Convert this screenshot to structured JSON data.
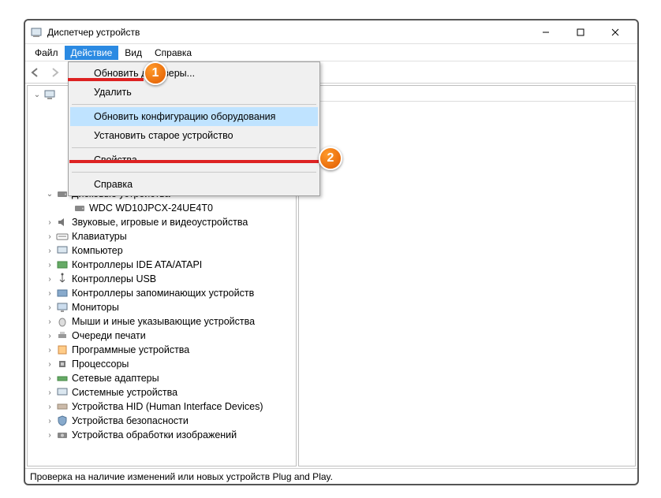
{
  "window": {
    "title": "Диспетчер устройств"
  },
  "menubar": {
    "file": "Файл",
    "action": "Действие",
    "view": "Вид",
    "help": "Справка"
  },
  "dropdown": {
    "update_drivers": "Обновить драйверы...",
    "delete": "Удалить",
    "scan_hw": "Обновить конфигурацию оборудования",
    "add_legacy": "Установить старое устройство",
    "properties": "Свойства",
    "help": "Справка"
  },
  "tree": {
    "root": "",
    "disk_devices": "Дисковые устройства",
    "disk_child": "WDC WD10JPCX-24UE4T0",
    "audio": "Звуковые, игровые и видеоустройства",
    "keyboards": "Клавиатуры",
    "computer": "Компьютер",
    "ide": "Контроллеры IDE ATA/ATAPI",
    "usb": "Контроллеры USB",
    "storage_ctrl": "Контроллеры запоминающих устройств",
    "monitors": "Мониторы",
    "mice": "Мыши и иные указывающие устройства",
    "print_queues": "Очереди печати",
    "software": "Программные устройства",
    "processors": "Процессоры",
    "network": "Сетевые адаптеры",
    "system": "Системные устройства",
    "hid": "Устройства HID (Human Interface Devices)",
    "security": "Устройства безопасности",
    "imaging": "Устройства обработки изображений"
  },
  "statusbar": {
    "text": "Проверка на наличие изменений или новых устройств Plug and Play."
  },
  "callouts": {
    "one": "1",
    "two": "2"
  }
}
